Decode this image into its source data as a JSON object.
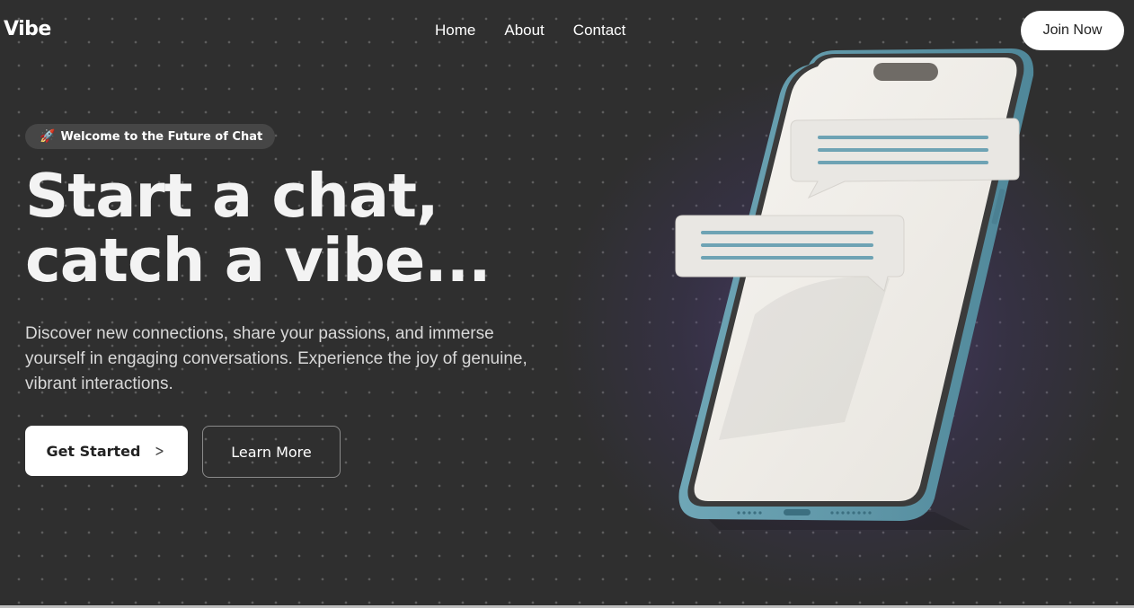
{
  "header": {
    "logo": "Vibe",
    "nav": [
      {
        "label": "Home"
      },
      {
        "label": "About"
      },
      {
        "label": "Contact"
      }
    ],
    "cta_label": "Join Now"
  },
  "hero": {
    "badge": {
      "icon": "rocket-icon",
      "text": "Welcome to the Future of Chat"
    },
    "headline": [
      "Start a chat,",
      "catch a vibe..."
    ],
    "description": "Discover new connections, share your passions, and immerse yourself in engaging conversations. Experience the joy of genuine, vibrant interactions.",
    "primary_button": {
      "label": "Get Started",
      "icon": "chevron-right-icon"
    },
    "secondary_button": {
      "label": "Learn More"
    }
  },
  "colors": {
    "background": "#2f2f2f",
    "accent_teal": "#5f9aab",
    "glow_purple": "#5f4696"
  }
}
